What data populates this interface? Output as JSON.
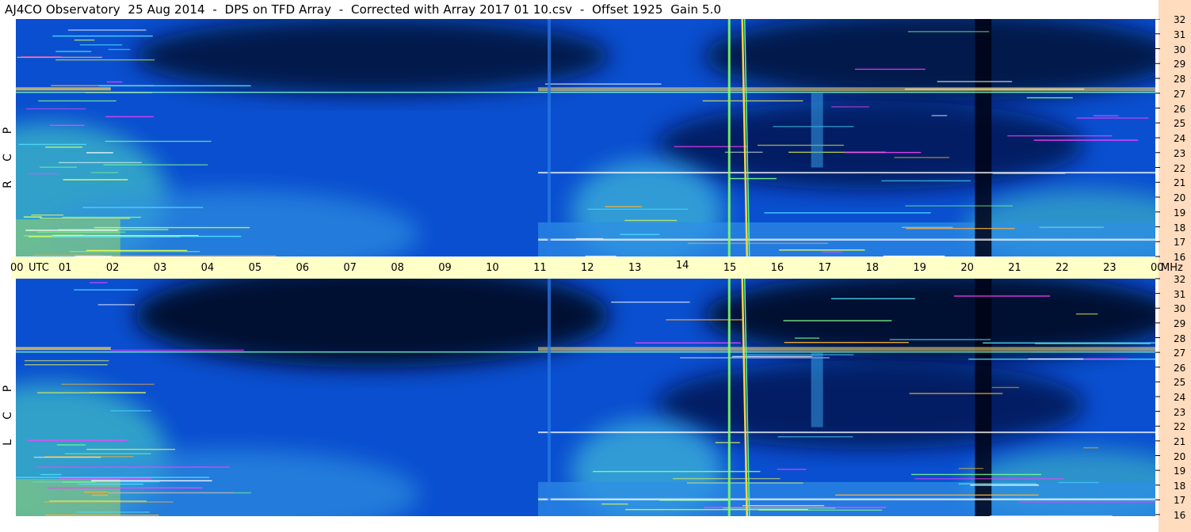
{
  "header": {
    "title": "AJ4CO Observatory  25 Aug 2014  -  DPS on TFD Array  -  Corrected with Array 2017 01 10.csv  -  Offset 1925  Gain 5.0"
  },
  "panels": [
    {
      "id": "rcp",
      "label_letters": [
        "R",
        "C",
        "P"
      ]
    },
    {
      "id": "lcp",
      "label_letters": [
        "L",
        "C",
        "P"
      ]
    }
  ],
  "time_axis": {
    "labels": [
      "00",
      "UTC",
      "01",
      "02",
      "03",
      "04",
      "05",
      "06",
      "07",
      "08",
      "09",
      "10",
      "11",
      "12",
      "13",
      "14",
      "15",
      "16",
      "17",
      "18",
      "19",
      "20",
      "21",
      "22",
      "23",
      "00",
      "MHz"
    ]
  },
  "freq_axis": {
    "labels": [
      "32",
      "31",
      "30",
      "29",
      "28",
      "27",
      "26",
      "25",
      "24",
      "23",
      "22",
      "21",
      "20",
      "19",
      "18",
      "17",
      "16"
    ]
  },
  "chart_data": {
    "type": "heatmap",
    "title": "AJ4CO Observatory  25 Aug 2014  -  DPS on TFD Array  -  Corrected with Array 2017 01 10.csv  -  Offset 1925  Gain 5.0",
    "xlabel": "UTC",
    "ylabel": "MHz",
    "x_range_hours": [
      0,
      24
    ],
    "y_range_mhz": [
      16,
      32
    ],
    "panels": [
      "RCP",
      "LCP"
    ],
    "colors": {
      "low": "#000820",
      "mid": "#0a5adc",
      "high": "#78ff78",
      "peak": "#ff00ff",
      "time_strip": "#ffffc8",
      "freq_strip": "#ffdcbe"
    },
    "features": [
      {
        "type": "strong emission band",
        "freq_mhz": [
          16,
          18.5
        ],
        "time_h": [
          0,
          2
        ]
      },
      {
        "type": "strong emission band",
        "freq_mhz": [
          16,
          19
        ],
        "time_h": [
          11,
          24
        ]
      },
      {
        "type": "interference line",
        "freq_mhz": 27.1,
        "time_h": [
          0,
          24
        ]
      },
      {
        "type": "interference line",
        "freq_mhz": 21.7,
        "time_h": [
          11,
          24
        ]
      },
      {
        "type": "vertical event",
        "time_h": 11.2
      },
      {
        "type": "vertical event",
        "time_h": 15.0
      },
      {
        "type": "vertical event",
        "time_h": 15.3
      },
      {
        "type": "dark band",
        "time_h": 20.3
      }
    ]
  }
}
